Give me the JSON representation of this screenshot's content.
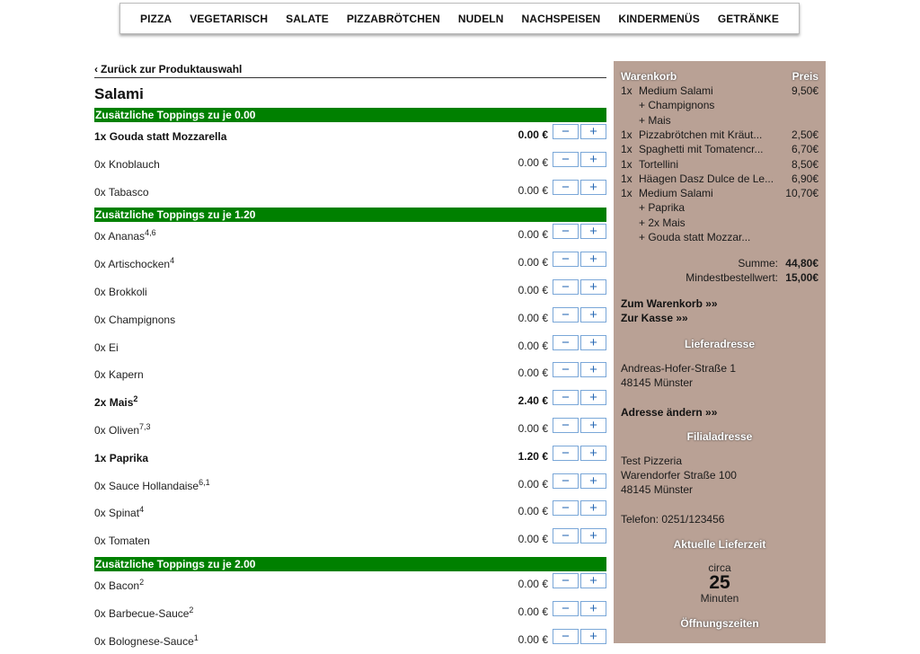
{
  "nav": {
    "items": [
      "PIZZA",
      "VEGETARISCH",
      "SALATE",
      "PIZZABRÖTCHEN",
      "NUDELN",
      "NACHSPEISEN",
      "KINDERMENÜS",
      "GETRÄNKE"
    ]
  },
  "left": {
    "back_link": "Zurück zur Produktauswahl",
    "product_title": "Salami",
    "minus_label": "−",
    "plus_label": "+",
    "sections": [
      {
        "header": "Zusätzliche Toppings zu je 0.00",
        "items": [
          {
            "qty": "1x",
            "name": "Gouda statt Mozzarella",
            "sup": "",
            "price": "0.00 €",
            "selected": true
          },
          {
            "qty": "0x",
            "name": "Knoblauch",
            "sup": "",
            "price": "0.00 €",
            "selected": false
          },
          {
            "qty": "0x",
            "name": "Tabasco",
            "sup": "",
            "price": "0.00 €",
            "selected": false
          }
        ]
      },
      {
        "header": "Zusätzliche Toppings zu je 1.20",
        "items": [
          {
            "qty": "0x",
            "name": "Ananas",
            "sup": "4,6",
            "price": "0.00 €",
            "selected": false
          },
          {
            "qty": "0x",
            "name": "Artischocken",
            "sup": "4",
            "price": "0.00 €",
            "selected": false
          },
          {
            "qty": "0x",
            "name": "Brokkoli",
            "sup": "",
            "price": "0.00 €",
            "selected": false
          },
          {
            "qty": "0x",
            "name": "Champignons",
            "sup": "",
            "price": "0.00 €",
            "selected": false
          },
          {
            "qty": "0x",
            "name": "Ei",
            "sup": "",
            "price": "0.00 €",
            "selected": false
          },
          {
            "qty": "0x",
            "name": "Kapern",
            "sup": "",
            "price": "0.00 €",
            "selected": false
          },
          {
            "qty": "2x",
            "name": "Mais",
            "sup": "2",
            "price": "2.40 €",
            "selected": true
          },
          {
            "qty": "0x",
            "name": "Oliven",
            "sup": "7,3",
            "price": "0.00 €",
            "selected": false
          },
          {
            "qty": "1x",
            "name": "Paprika",
            "sup": "",
            "price": "1.20 €",
            "selected": true
          },
          {
            "qty": "0x",
            "name": "Sauce Hollandaise",
            "sup": "6,1",
            "price": "0.00 €",
            "selected": false
          },
          {
            "qty": "0x",
            "name": "Spinat",
            "sup": "4",
            "price": "0.00 €",
            "selected": false
          },
          {
            "qty": "0x",
            "name": "Tomaten",
            "sup": "",
            "price": "0.00 €",
            "selected": false
          }
        ]
      },
      {
        "header": "Zusätzliche Toppings zu je 2.00",
        "items": [
          {
            "qty": "0x",
            "name": "Bacon",
            "sup": "2",
            "price": "0.00 €",
            "selected": false
          },
          {
            "qty": "0x",
            "name": "Barbecue-Sauce",
            "sup": "2",
            "price": "0.00 €",
            "selected": false
          },
          {
            "qty": "0x",
            "name": "Bolognese-Sauce",
            "sup": "1",
            "price": "0.00 €",
            "selected": false
          }
        ]
      }
    ]
  },
  "cart": {
    "header_label": "Warenkorb",
    "header_price": "Preis",
    "lines": [
      {
        "qty": "1x",
        "name": "Medium Salami",
        "price": "9,50€",
        "subs": [
          "+ Champignons",
          "+ Mais"
        ]
      },
      {
        "qty": "1x",
        "name": "Pizzabrötchen mit Kräut...",
        "price": "2,50€",
        "subs": []
      },
      {
        "qty": "1x",
        "name": "Spaghetti mit Tomatencr...",
        "price": "6,70€",
        "subs": []
      },
      {
        "qty": "1x",
        "name": "Tortellini",
        "price": "8,50€",
        "subs": []
      },
      {
        "qty": "1x",
        "name": "Häagen Dasz Dulce de Le...",
        "price": "6,90€",
        "subs": []
      },
      {
        "qty": "1x",
        "name": "Medium Salami",
        "price": "10,70€",
        "subs": [
          "+ Paprika",
          "+ 2x Mais",
          "+ Gouda statt Mozzar..."
        ]
      }
    ],
    "sum_label": "Summe:",
    "sum_value": "44,80€",
    "min_label": "Mindestbestellwert:",
    "min_value": "15,00€",
    "to_cart": "Zum Warenkorb »»",
    "to_checkout": "Zur Kasse »»",
    "delivery_heading": "Lieferadresse",
    "delivery_street": "Andreas-Hofer-Straße 1",
    "delivery_city": "48145 Münster",
    "change_address": "Adresse ändern »»",
    "branch_heading": "Filialadresse",
    "branch_name": "Test Pizzeria",
    "branch_street": "Warendorfer Straße 100",
    "branch_city": "48145 Münster",
    "branch_phone": "Telefon: 0251/123456",
    "delivery_time_heading": "Aktuelle Lieferzeit",
    "circa": "circa",
    "minutes_value": "25",
    "minutes_label": "Minuten",
    "opening_heading": "Öffnungszeiten"
  }
}
